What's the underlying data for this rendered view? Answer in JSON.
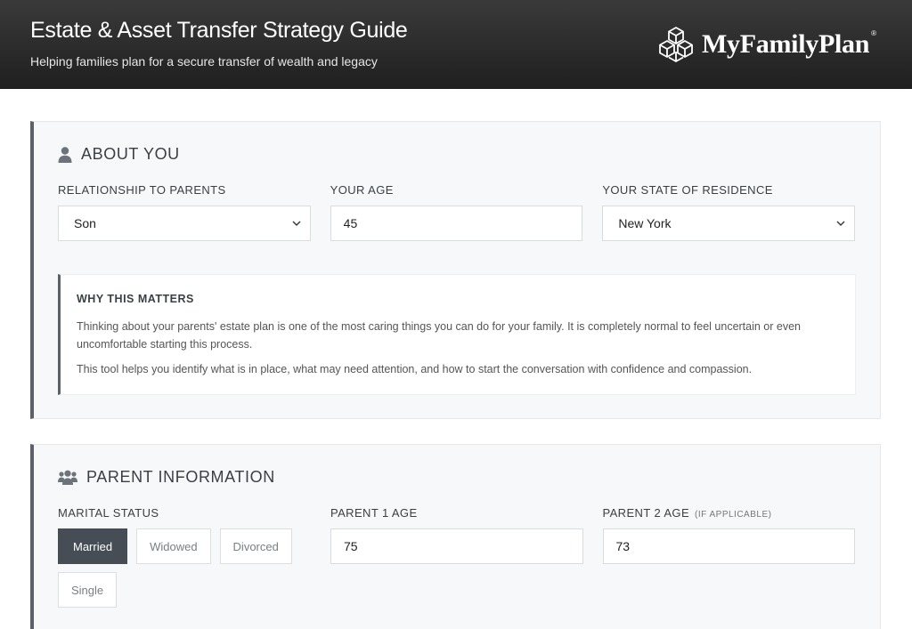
{
  "header": {
    "title": "Estate & Asset Transfer Strategy Guide",
    "subtitle": "Helping families plan for a secure transfer of wealth and legacy",
    "logo_text": "MyFamilyPlan",
    "logo_reg": "®"
  },
  "about": {
    "title": "ABOUT YOU",
    "icon": "user-icon",
    "relationship": {
      "label": "RELATIONSHIP TO PARENTS",
      "value": "Son"
    },
    "age": {
      "label": "YOUR AGE",
      "value": "45"
    },
    "state": {
      "label": "YOUR STATE OF RESIDENCE",
      "value": "New York"
    },
    "why": {
      "title": "WHY THIS MATTERS",
      "p1": "Thinking about your parents' estate plan is one of the most caring things you can do for your family. It is completely normal to feel uncertain or even uncomfortable starting this process.",
      "p2": "This tool helps you identify what is in place, what may need attention, and how to start the conversation with confidence and compassion."
    }
  },
  "parent": {
    "title": "PARENT INFORMATION",
    "icon": "users-icon",
    "marital": {
      "label": "MARITAL STATUS",
      "options": [
        "Married",
        "Widowed",
        "Divorced",
        "Single"
      ],
      "selected": "Married"
    },
    "parent1_age": {
      "label": "PARENT 1 AGE",
      "value": "75"
    },
    "parent2_age": {
      "label": "PARENT 2 AGE",
      "note": "(IF APPLICABLE)",
      "value": "73"
    }
  },
  "colors": {
    "header_bg": "#2b2b2b",
    "accent": "#5b6168",
    "active_pill": "#474d54",
    "card_bg": "#f7f8f9"
  }
}
